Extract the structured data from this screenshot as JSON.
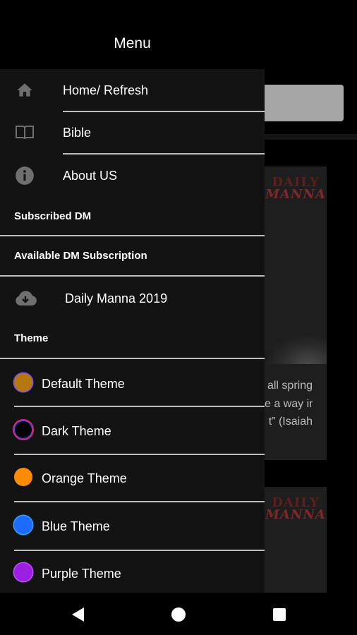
{
  "header": {
    "title": "Menu"
  },
  "background": {
    "logo": {
      "line1": "DAILY",
      "line2": "MANNA"
    },
    "verse_lines": [
      "all spring",
      "e a way in",
      "t” (Isaiah"
    ]
  },
  "drawer": {
    "nav_items": [
      {
        "label": "Home/ Refresh",
        "icon": "home-icon"
      },
      {
        "label": "Bible",
        "icon": "book-icon"
      },
      {
        "label": "About US",
        "icon": "info-icon"
      }
    ],
    "sections": {
      "subscribed": "Subscribed DM",
      "available": "Available DM Subscription",
      "theme": "Theme"
    },
    "available_item": {
      "label": "Daily Manna 2019",
      "icon": "cloud-download-icon"
    },
    "themes": [
      {
        "label": "Default Theme",
        "color": "#b5770f"
      },
      {
        "label": "Dark Theme",
        "color": "#000000"
      },
      {
        "label": "Orange Theme",
        "color": "#ff8c00"
      },
      {
        "label": "Blue Theme",
        "color": "#1e6bff"
      },
      {
        "label": "Purple Theme",
        "color": "#9b1fe0"
      }
    ]
  },
  "navbar": {
    "back": "back-icon",
    "home": "home-circle-icon",
    "recents": "recents-icon"
  }
}
